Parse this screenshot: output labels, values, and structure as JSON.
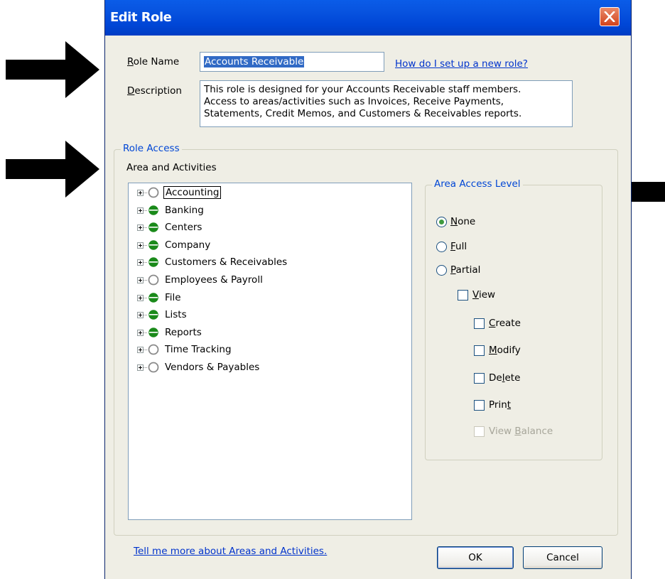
{
  "window": {
    "title": "Edit Role"
  },
  "role_name": {
    "label": "Role Name",
    "value": "Accounts Receivable",
    "help_link": "How do I set up a new role?"
  },
  "description": {
    "label": "Description",
    "lines": [
      "This role is designed for your Accounts Receivable staff members.",
      "Access to areas/activities such as Invoices, Receive Payments,",
      "Statements, Credit Memos, and Customers & Receivables reports."
    ]
  },
  "role_access": {
    "legend": "Role Access",
    "tree_label": "Area and Activities",
    "tree_items": [
      {
        "label": "Accounting",
        "status": "none"
      },
      {
        "label": "Banking",
        "status": "partial"
      },
      {
        "label": "Centers",
        "status": "partial"
      },
      {
        "label": "Company",
        "status": "partial"
      },
      {
        "label": "Customers & Receivables",
        "status": "partial"
      },
      {
        "label": "Employees & Payroll",
        "status": "none"
      },
      {
        "label": "File",
        "status": "partial"
      },
      {
        "label": "Lists",
        "status": "partial"
      },
      {
        "label": "Reports",
        "status": "partial"
      },
      {
        "label": "Time Tracking",
        "status": "none"
      },
      {
        "label": "Vendors & Payables",
        "status": "none"
      }
    ],
    "selected_item": "Accounting"
  },
  "access_level": {
    "legend": "Area Access Level",
    "options": [
      "None",
      "Full",
      "Partial"
    ],
    "selected": "None",
    "checks": {
      "view": "View",
      "create": "Create",
      "modify": "Modify",
      "delete": "Delete",
      "print": "Print",
      "view_balance": "View Balance"
    }
  },
  "footer": {
    "link": "Tell me more about Areas and Activities.",
    "ok": "OK",
    "cancel": "Cancel"
  },
  "colors": {
    "title_bar": "#0054e3",
    "dialog_bg": "#efeee5",
    "link": "#0033cc",
    "partial_icon": "#1a8a1a",
    "legend_text": "#0046d5"
  }
}
